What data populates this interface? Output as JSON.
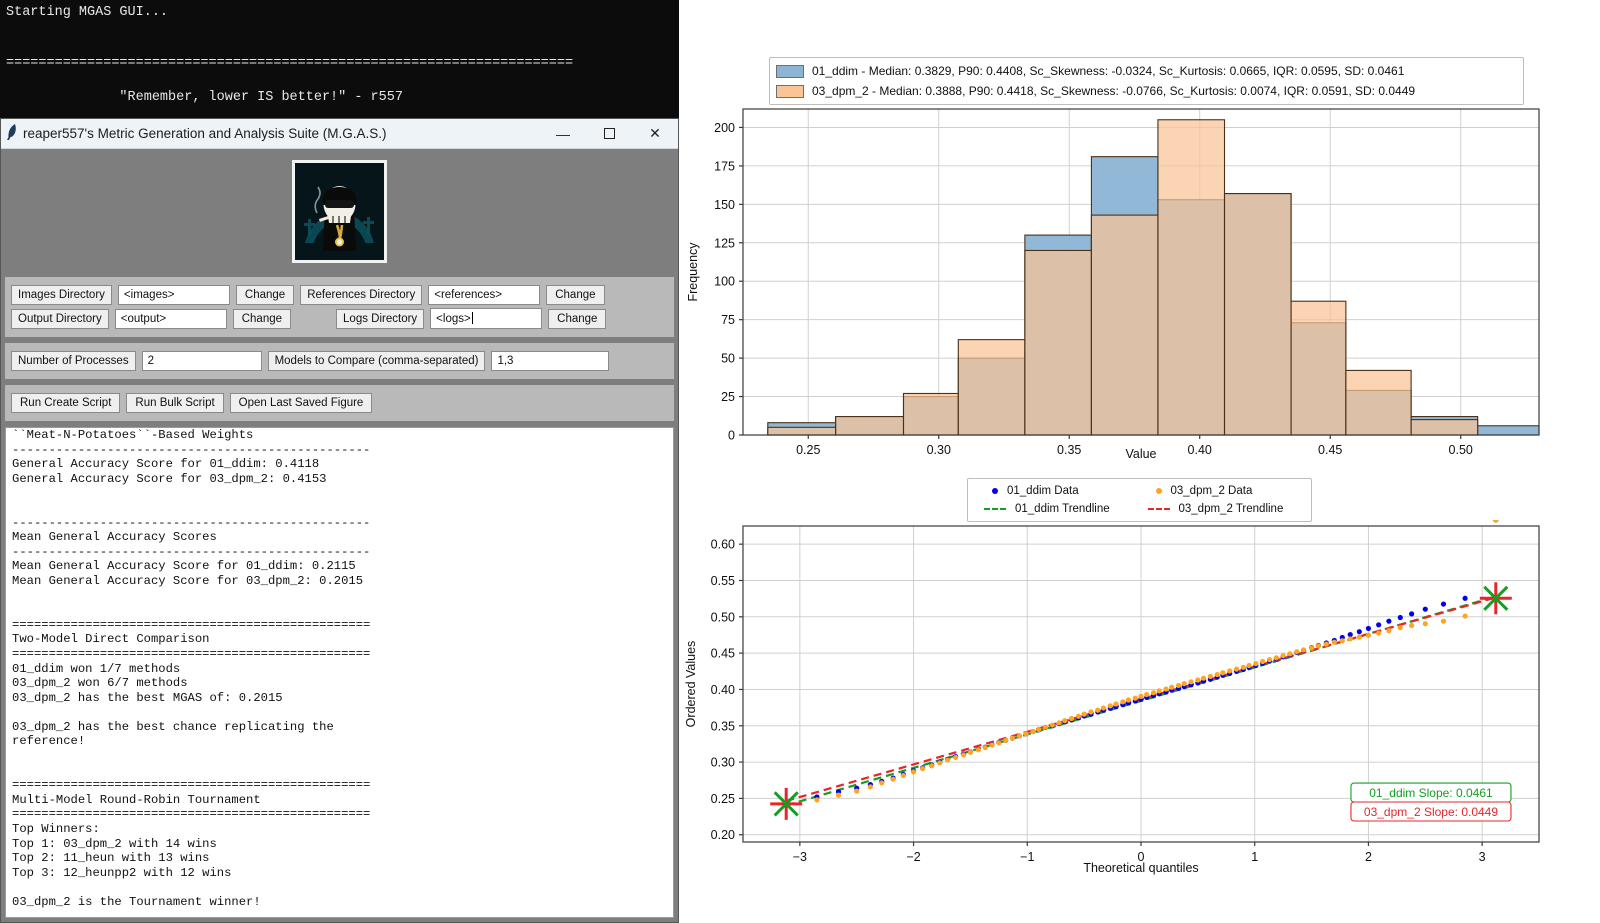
{
  "terminal": {
    "lines": [
      "Starting MGAS GUI...",
      "",
      "",
      "======================================================================",
      "",
      "              \"Remember, lower IS better!\" - r557",
      "",
      "======================================================================"
    ]
  },
  "window": {
    "title": "reaper557's Metric Generation and Analysis Suite (M.G.A.S.)",
    "app_icon": "feather-icon",
    "minimize": "—",
    "maximize": "☐",
    "close": "✕",
    "logo_alt": "reaper-skull-logo"
  },
  "form": {
    "images_directory": {
      "label": "Images Directory",
      "value": "<images>",
      "button": "Change"
    },
    "references_directory": {
      "label": "References Directory",
      "value": "<references>",
      "button": "Change"
    },
    "output_directory": {
      "label": "Output Directory",
      "value": "<output>",
      "button": "Change"
    },
    "logs_directory": {
      "label": "Logs Directory",
      "value": "<logs>",
      "button": "Change"
    },
    "number_of_processes": {
      "label": "Number of Processes",
      "value": "2"
    },
    "models_to_compare": {
      "label": "Models to Compare (comma-separated)",
      "value": "1,3"
    }
  },
  "actions": {
    "run_create_script": "Run Create Script",
    "run_bulk_script": "Run Bulk Script",
    "open_last_saved_figure": "Open Last Saved Figure"
  },
  "console": {
    "text": "``Meat-N-Potatoes``-Based Weights\n-------------------------------------------------\nGeneral Accuracy Score for 01_ddim: 0.4118\nGeneral Accuracy Score for 03_dpm_2: 0.4153\n\n\n-------------------------------------------------\nMean General Accuracy Scores\n-------------------------------------------------\nMean General Accuracy Score for 01_ddim: 0.2115\nMean General Accuracy Score for 03_dpm_2: 0.2015\n\n\n=================================================\nTwo-Model Direct Comparison\n=================================================\n01_ddim won 1/7 methods\n03_dpm_2 won 6/7 methods\n03_dpm_2 has the best MGAS of: 0.2015\n\n03_dpm_2 has the best chance replicating the\nreference!\n\n\n=================================================\nMulti-Model Round-Robin Tournament\n=================================================\nTop Winners:\nTop 1: 03_dpm_2 with 14 wins\nTop 2: 11_heun with 13 wins\nTop 3: 12_heunpp2 with 12 wins\n\n03_dpm_2 is the Tournament winner!"
  },
  "colors": {
    "series_a": "#8cb4d5",
    "series_b": "#fac496",
    "overlap": "#c09a6b",
    "series_a_dot": "#0000ee",
    "series_b_dot": "#ffa51e",
    "trend_a": "#12a020",
    "trend_b": "#e8262a",
    "grid": "#d0d0d0",
    "edge": "#5a3b1a"
  },
  "chart_data": [
    {
      "type": "bar",
      "id": "histogram",
      "title": "",
      "xlabel": "Value",
      "ylabel": "Frequency",
      "xlim": [
        0.225,
        0.53
      ],
      "ylim": [
        0,
        212
      ],
      "xticks": [
        0.25,
        0.3,
        0.35,
        0.4,
        0.45,
        0.5
      ],
      "yticks": [
        0,
        25,
        50,
        75,
        100,
        125,
        150,
        175,
        200
      ],
      "grid": true,
      "legend_position": "above-axes",
      "bin_edges": [
        0.2345,
        0.2605,
        0.2865,
        0.3075,
        0.333,
        0.3585,
        0.384,
        0.4095,
        0.435,
        0.456,
        0.481,
        0.5065,
        0.53
      ],
      "series": [
        {
          "name": "01_ddim",
          "color": "#8cb4d5",
          "legend": "01_ddim - Median: 0.3829, P90: 0.4408, Sc_Skewness: -0.0324, Sc_Kurtosis: 0.0665, IQR: 0.0595, SD: 0.0461",
          "stats": {
            "median": 0.3829,
            "p90": 0.4408,
            "sc_skewness": -0.0324,
            "sc_kurtosis": 0.0665,
            "iqr": 0.0595,
            "sd": 0.0461
          },
          "values": [
            8,
            12,
            25,
            50,
            130,
            181,
            153,
            157,
            73,
            29,
            12,
            6
          ]
        },
        {
          "name": "03_dpm_2",
          "color": "#fac496",
          "legend": "03_dpm_2 - Median: 0.3888, P90: 0.4418, Sc_Skewness: -0.0766, Sc_Kurtosis: 0.0074, IQR: 0.0591, SD: 0.0449",
          "stats": {
            "median": 0.3888,
            "p90": 0.4418,
            "sc_skewness": -0.0766,
            "sc_kurtosis": 0.0074,
            "iqr": 0.0591,
            "sd": 0.0449
          },
          "values": [
            5,
            12,
            27,
            62,
            120,
            143,
            205,
            157,
            87,
            42,
            10,
            0
          ]
        }
      ]
    },
    {
      "type": "scatter",
      "id": "qq-plot",
      "title": "",
      "xlabel": "Theoretical quantiles",
      "ylabel": "Ordered Values",
      "xlim": [
        -3.5,
        3.5
      ],
      "ylim": [
        0.19,
        0.625
      ],
      "xticks": [
        -3,
        -2,
        -1,
        0,
        1,
        2,
        3
      ],
      "yticks": [
        0.2,
        0.25,
        0.3,
        0.35,
        0.4,
        0.45,
        0.5,
        0.55,
        0.6
      ],
      "grid": true,
      "legend_position": "above-axes",
      "legend_entries": [
        {
          "label": "01_ddim Data",
          "marker": "dot",
          "color": "#0000ee"
        },
        {
          "label": "03_dpm_2 Data",
          "marker": "dot",
          "color": "#ffa51e"
        },
        {
          "label": "01_ddim Trendline",
          "marker": "dashed-line",
          "color": "#12a020"
        },
        {
          "label": "03_dpm_2 Trendline",
          "marker": "dashed-line",
          "color": "#e8262a"
        }
      ],
      "annotations": [
        {
          "text": "01_ddim Slope: 0.0461",
          "color": "#12a020",
          "x": 2.55,
          "y": 0.258
        },
        {
          "text": "03_dpm_2 Slope: 0.0449",
          "color": "#e8262a",
          "x": 2.55,
          "y": 0.232
        }
      ],
      "endpoint_markers": [
        {
          "x": -3.12,
          "y": 0.2425,
          "shapes": [
            "red-plus",
            "green-x"
          ]
        },
        {
          "x": 3.12,
          "y": 0.5255,
          "shapes": [
            "red-plus",
            "green-x"
          ]
        }
      ],
      "trendlines": [
        {
          "name": "01_ddim Trendline",
          "color": "#12a020",
          "slope": 0.0461,
          "intercept": 0.3842,
          "x_range": [
            -3.12,
            3.12
          ]
        },
        {
          "name": "03_dpm_2 Trendline",
          "color": "#e8262a",
          "slope": 0.0449,
          "intercept": 0.3866,
          "x_range": [
            -3.12,
            3.12
          ]
        }
      ],
      "series": [
        {
          "name": "01_ddim Data",
          "color": "#0000ee",
          "x": [
            -3.12,
            -2.85,
            -2.66,
            -2.5,
            -2.38,
            -2.28,
            -2.18,
            -2.09,
            -2.0,
            -1.92,
            -1.84,
            -1.77,
            -1.7,
            -1.63,
            -1.56,
            -1.5,
            -1.43,
            -1.37,
            -1.31,
            -1.25,
            -1.19,
            -1.13,
            -1.07,
            -1.01,
            -0.95,
            -0.9,
            -0.84,
            -0.78,
            -0.72,
            -0.67,
            -0.61,
            -0.55,
            -0.5,
            -0.44,
            -0.38,
            -0.33,
            -0.27,
            -0.22,
            -0.16,
            -0.11,
            -0.05,
            0.0,
            0.05,
            0.11,
            0.16,
            0.22,
            0.27,
            0.33,
            0.38,
            0.44,
            0.5,
            0.55,
            0.61,
            0.67,
            0.72,
            0.78,
            0.84,
            0.9,
            0.95,
            1.01,
            1.07,
            1.13,
            1.19,
            1.25,
            1.31,
            1.37,
            1.43,
            1.5,
            1.56,
            1.63,
            1.7,
            1.77,
            1.84,
            1.92,
            2.0,
            2.09,
            2.18,
            2.28,
            2.38,
            2.5,
            2.66,
            2.85,
            3.12
          ],
          "y": [
            0.2425,
            0.252,
            0.259,
            0.264,
            0.269,
            0.2735,
            0.278,
            0.283,
            0.288,
            0.292,
            0.296,
            0.3,
            0.304,
            0.3075,
            0.311,
            0.314,
            0.3175,
            0.3205,
            0.324,
            0.327,
            0.33,
            0.333,
            0.336,
            0.339,
            0.342,
            0.3445,
            0.3475,
            0.35,
            0.353,
            0.3555,
            0.358,
            0.361,
            0.3635,
            0.366,
            0.369,
            0.3715,
            0.374,
            0.3765,
            0.379,
            0.3815,
            0.384,
            0.3865,
            0.389,
            0.3915,
            0.394,
            0.3965,
            0.399,
            0.4015,
            0.404,
            0.4065,
            0.409,
            0.4115,
            0.414,
            0.417,
            0.4195,
            0.422,
            0.425,
            0.4275,
            0.4305,
            0.433,
            0.436,
            0.439,
            0.442,
            0.445,
            0.448,
            0.451,
            0.454,
            0.4575,
            0.4605,
            0.464,
            0.4675,
            0.4715,
            0.4755,
            0.4795,
            0.484,
            0.489,
            0.494,
            0.499,
            0.504,
            0.5105,
            0.5175,
            0.5255
          ]
        },
        {
          "name": "03_dpm_2 Data",
          "color": "#ffa51e",
          "x": [
            -3.12,
            -2.85,
            -2.66,
            -2.5,
            -2.38,
            -2.28,
            -2.18,
            -2.09,
            -2.0,
            -1.92,
            -1.84,
            -1.77,
            -1.7,
            -1.63,
            -1.56,
            -1.5,
            -1.43,
            -1.37,
            -1.31,
            -1.25,
            -1.19,
            -1.13,
            -1.07,
            -1.01,
            -0.95,
            -0.9,
            -0.84,
            -0.78,
            -0.72,
            -0.67,
            -0.61,
            -0.55,
            -0.5,
            -0.44,
            -0.38,
            -0.33,
            -0.27,
            -0.22,
            -0.16,
            -0.11,
            -0.05,
            0.0,
            0.05,
            0.11,
            0.16,
            0.22,
            0.27,
            0.33,
            0.38,
            0.44,
            0.5,
            0.55,
            0.61,
            0.67,
            0.72,
            0.78,
            0.84,
            0.9,
            0.95,
            1.01,
            1.07,
            1.13,
            1.19,
            1.25,
            1.31,
            1.37,
            1.43,
            1.5,
            1.56,
            1.63,
            1.7,
            1.77,
            1.84,
            1.92,
            2.0,
            2.09,
            2.18,
            2.28,
            2.38,
            2.5,
            2.66,
            2.85,
            3.12
          ],
          "y": [
            0.24,
            0.248,
            0.2545,
            0.26,
            0.266,
            0.2715,
            0.2765,
            0.2815,
            0.2865,
            0.291,
            0.295,
            0.299,
            0.303,
            0.3065,
            0.31,
            0.3135,
            0.317,
            0.32,
            0.3235,
            0.3265,
            0.33,
            0.333,
            0.336,
            0.339,
            0.342,
            0.345,
            0.348,
            0.351,
            0.354,
            0.357,
            0.36,
            0.363,
            0.366,
            0.369,
            0.3715,
            0.3745,
            0.3775,
            0.38,
            0.383,
            0.3855,
            0.388,
            0.3905,
            0.393,
            0.3955,
            0.398,
            0.4005,
            0.403,
            0.4055,
            0.408,
            0.4105,
            0.413,
            0.4155,
            0.418,
            0.4205,
            0.423,
            0.4255,
            0.428,
            0.4305,
            0.433,
            0.4355,
            0.4385,
            0.441,
            0.4435,
            0.4465,
            0.449,
            0.452,
            0.4545,
            0.457,
            0.46,
            0.4625,
            0.465,
            0.467,
            0.4695,
            0.472,
            0.4745,
            0.4775,
            0.481,
            0.485,
            0.488,
            0.4905,
            0.494,
            0.501
          ]
        }
      ]
    }
  ]
}
